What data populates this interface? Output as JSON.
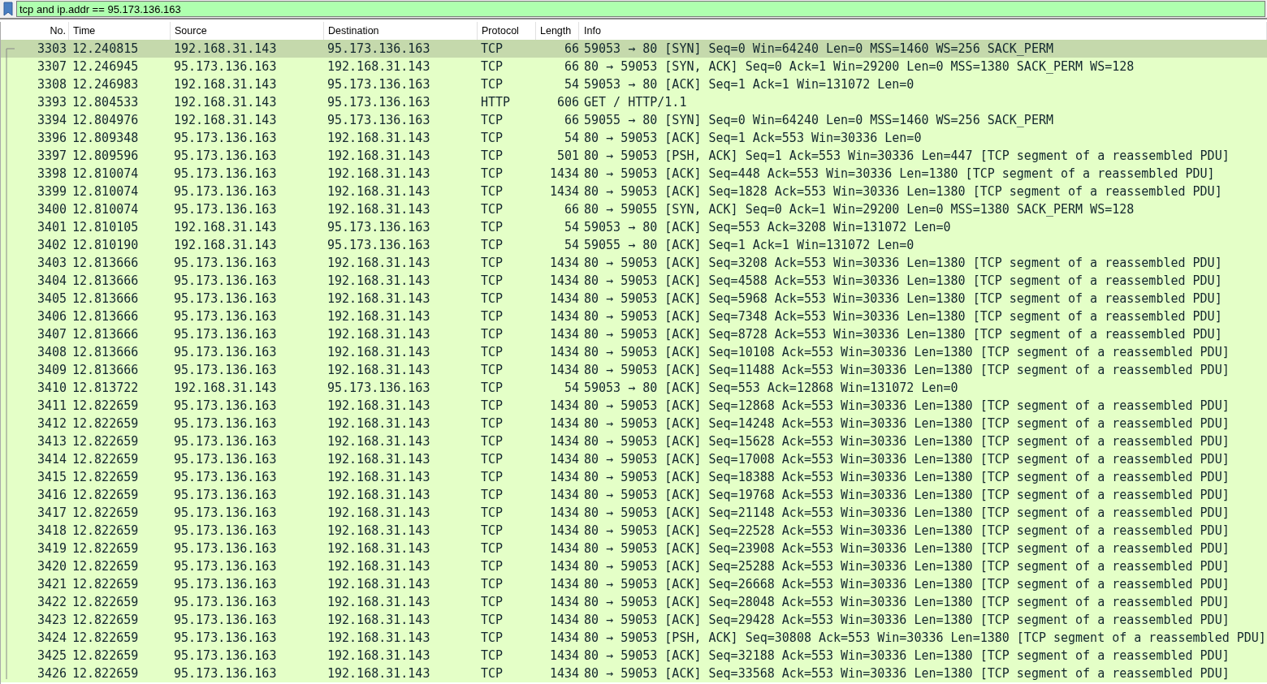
{
  "filter_bar": {
    "value": "tcp and ip.addr == 95.173.136.163"
  },
  "table": {
    "columns": [
      "No.",
      "Time",
      "Source",
      "Destination",
      "Protocol",
      "Length",
      "Info"
    ],
    "rows": [
      {
        "no": "3303",
        "time": "12.240815",
        "source": "192.168.31.143",
        "destination": "95.173.136.163",
        "protocol": "TCP",
        "length": "66",
        "info": "59053 → 80 [SYN] Seq=0 Win=64240 Len=0 MSS=1460 WS=256 SACK_PERM",
        "selected": true
      },
      {
        "no": "3307",
        "time": "12.246945",
        "source": "95.173.136.163",
        "destination": "192.168.31.143",
        "protocol": "TCP",
        "length": "66",
        "info": "80 → 59053 [SYN, ACK] Seq=0 Ack=1 Win=29200 Len=0 MSS=1380 SACK_PERM WS=128",
        "selected": false
      },
      {
        "no": "3308",
        "time": "12.246983",
        "source": "192.168.31.143",
        "destination": "95.173.136.163",
        "protocol": "TCP",
        "length": "54",
        "info": "59053 → 80 [ACK] Seq=1 Ack=1 Win=131072 Len=0",
        "selected": false
      },
      {
        "no": "3393",
        "time": "12.804533",
        "source": "192.168.31.143",
        "destination": "95.173.136.163",
        "protocol": "HTTP",
        "length": "606",
        "info": "GET / HTTP/1.1",
        "selected": false
      },
      {
        "no": "3394",
        "time": "12.804976",
        "source": "192.168.31.143",
        "destination": "95.173.136.163",
        "protocol": "TCP",
        "length": "66",
        "info": "59055 → 80 [SYN] Seq=0 Win=64240 Len=0 MSS=1460 WS=256 SACK_PERM",
        "selected": false
      },
      {
        "no": "3396",
        "time": "12.809348",
        "source": "95.173.136.163",
        "destination": "192.168.31.143",
        "protocol": "TCP",
        "length": "54",
        "info": "80 → 59053 [ACK] Seq=1 Ack=553 Win=30336 Len=0",
        "selected": false
      },
      {
        "no": "3397",
        "time": "12.809596",
        "source": "95.173.136.163",
        "destination": "192.168.31.143",
        "protocol": "TCP",
        "length": "501",
        "info": "80 → 59053 [PSH, ACK] Seq=1 Ack=553 Win=30336 Len=447 [TCP segment of a reassembled PDU]",
        "selected": false
      },
      {
        "no": "3398",
        "time": "12.810074",
        "source": "95.173.136.163",
        "destination": "192.168.31.143",
        "protocol": "TCP",
        "length": "1434",
        "info": "80 → 59053 [ACK] Seq=448 Ack=553 Win=30336 Len=1380 [TCP segment of a reassembled PDU]",
        "selected": false
      },
      {
        "no": "3399",
        "time": "12.810074",
        "source": "95.173.136.163",
        "destination": "192.168.31.143",
        "protocol": "TCP",
        "length": "1434",
        "info": "80 → 59053 [ACK] Seq=1828 Ack=553 Win=30336 Len=1380 [TCP segment of a reassembled PDU]",
        "selected": false
      },
      {
        "no": "3400",
        "time": "12.810074",
        "source": "95.173.136.163",
        "destination": "192.168.31.143",
        "protocol": "TCP",
        "length": "66",
        "info": "80 → 59055 [SYN, ACK] Seq=0 Ack=1 Win=29200 Len=0 MSS=1380 SACK_PERM WS=128",
        "selected": false
      },
      {
        "no": "3401",
        "time": "12.810105",
        "source": "192.168.31.143",
        "destination": "95.173.136.163",
        "protocol": "TCP",
        "length": "54",
        "info": "59053 → 80 [ACK] Seq=553 Ack=3208 Win=131072 Len=0",
        "selected": false
      },
      {
        "no": "3402",
        "time": "12.810190",
        "source": "192.168.31.143",
        "destination": "95.173.136.163",
        "protocol": "TCP",
        "length": "54",
        "info": "59055 → 80 [ACK] Seq=1 Ack=1 Win=131072 Len=0",
        "selected": false
      },
      {
        "no": "3403",
        "time": "12.813666",
        "source": "95.173.136.163",
        "destination": "192.168.31.143",
        "protocol": "TCP",
        "length": "1434",
        "info": "80 → 59053 [ACK] Seq=3208 Ack=553 Win=30336 Len=1380 [TCP segment of a reassembled PDU]",
        "selected": false
      },
      {
        "no": "3404",
        "time": "12.813666",
        "source": "95.173.136.163",
        "destination": "192.168.31.143",
        "protocol": "TCP",
        "length": "1434",
        "info": "80 → 59053 [ACK] Seq=4588 Ack=553 Win=30336 Len=1380 [TCP segment of a reassembled PDU]",
        "selected": false
      },
      {
        "no": "3405",
        "time": "12.813666",
        "source": "95.173.136.163",
        "destination": "192.168.31.143",
        "protocol": "TCP",
        "length": "1434",
        "info": "80 → 59053 [ACK] Seq=5968 Ack=553 Win=30336 Len=1380 [TCP segment of a reassembled PDU]",
        "selected": false
      },
      {
        "no": "3406",
        "time": "12.813666",
        "source": "95.173.136.163",
        "destination": "192.168.31.143",
        "protocol": "TCP",
        "length": "1434",
        "info": "80 → 59053 [ACK] Seq=7348 Ack=553 Win=30336 Len=1380 [TCP segment of a reassembled PDU]",
        "selected": false
      },
      {
        "no": "3407",
        "time": "12.813666",
        "source": "95.173.136.163",
        "destination": "192.168.31.143",
        "protocol": "TCP",
        "length": "1434",
        "info": "80 → 59053 [ACK] Seq=8728 Ack=553 Win=30336 Len=1380 [TCP segment of a reassembled PDU]",
        "selected": false
      },
      {
        "no": "3408",
        "time": "12.813666",
        "source": "95.173.136.163",
        "destination": "192.168.31.143",
        "protocol": "TCP",
        "length": "1434",
        "info": "80 → 59053 [ACK] Seq=10108 Ack=553 Win=30336 Len=1380 [TCP segment of a reassembled PDU]",
        "selected": false
      },
      {
        "no": "3409",
        "time": "12.813666",
        "source": "95.173.136.163",
        "destination": "192.168.31.143",
        "protocol": "TCP",
        "length": "1434",
        "info": "80 → 59053 [ACK] Seq=11488 Ack=553 Win=30336 Len=1380 [TCP segment of a reassembled PDU]",
        "selected": false
      },
      {
        "no": "3410",
        "time": "12.813722",
        "source": "192.168.31.143",
        "destination": "95.173.136.163",
        "protocol": "TCP",
        "length": "54",
        "info": "59053 → 80 [ACK] Seq=553 Ack=12868 Win=131072 Len=0",
        "selected": false
      },
      {
        "no": "3411",
        "time": "12.822659",
        "source": "95.173.136.163",
        "destination": "192.168.31.143",
        "protocol": "TCP",
        "length": "1434",
        "info": "80 → 59053 [ACK] Seq=12868 Ack=553 Win=30336 Len=1380 [TCP segment of a reassembled PDU]",
        "selected": false
      },
      {
        "no": "3412",
        "time": "12.822659",
        "source": "95.173.136.163",
        "destination": "192.168.31.143",
        "protocol": "TCP",
        "length": "1434",
        "info": "80 → 59053 [ACK] Seq=14248 Ack=553 Win=30336 Len=1380 [TCP segment of a reassembled PDU]",
        "selected": false
      },
      {
        "no": "3413",
        "time": "12.822659",
        "source": "95.173.136.163",
        "destination": "192.168.31.143",
        "protocol": "TCP",
        "length": "1434",
        "info": "80 → 59053 [ACK] Seq=15628 Ack=553 Win=30336 Len=1380 [TCP segment of a reassembled PDU]",
        "selected": false
      },
      {
        "no": "3414",
        "time": "12.822659",
        "source": "95.173.136.163",
        "destination": "192.168.31.143",
        "protocol": "TCP",
        "length": "1434",
        "info": "80 → 59053 [ACK] Seq=17008 Ack=553 Win=30336 Len=1380 [TCP segment of a reassembled PDU]",
        "selected": false
      },
      {
        "no": "3415",
        "time": "12.822659",
        "source": "95.173.136.163",
        "destination": "192.168.31.143",
        "protocol": "TCP",
        "length": "1434",
        "info": "80 → 59053 [ACK] Seq=18388 Ack=553 Win=30336 Len=1380 [TCP segment of a reassembled PDU]",
        "selected": false
      },
      {
        "no": "3416",
        "time": "12.822659",
        "source": "95.173.136.163",
        "destination": "192.168.31.143",
        "protocol": "TCP",
        "length": "1434",
        "info": "80 → 59053 [ACK] Seq=19768 Ack=553 Win=30336 Len=1380 [TCP segment of a reassembled PDU]",
        "selected": false
      },
      {
        "no": "3417",
        "time": "12.822659",
        "source": "95.173.136.163",
        "destination": "192.168.31.143",
        "protocol": "TCP",
        "length": "1434",
        "info": "80 → 59053 [ACK] Seq=21148 Ack=553 Win=30336 Len=1380 [TCP segment of a reassembled PDU]",
        "selected": false
      },
      {
        "no": "3418",
        "time": "12.822659",
        "source": "95.173.136.163",
        "destination": "192.168.31.143",
        "protocol": "TCP",
        "length": "1434",
        "info": "80 → 59053 [ACK] Seq=22528 Ack=553 Win=30336 Len=1380 [TCP segment of a reassembled PDU]",
        "selected": false
      },
      {
        "no": "3419",
        "time": "12.822659",
        "source": "95.173.136.163",
        "destination": "192.168.31.143",
        "protocol": "TCP",
        "length": "1434",
        "info": "80 → 59053 [ACK] Seq=23908 Ack=553 Win=30336 Len=1380 [TCP segment of a reassembled PDU]",
        "selected": false
      },
      {
        "no": "3420",
        "time": "12.822659",
        "source": "95.173.136.163",
        "destination": "192.168.31.143",
        "protocol": "TCP",
        "length": "1434",
        "info": "80 → 59053 [ACK] Seq=25288 Ack=553 Win=30336 Len=1380 [TCP segment of a reassembled PDU]",
        "selected": false
      },
      {
        "no": "3421",
        "time": "12.822659",
        "source": "95.173.136.163",
        "destination": "192.168.31.143",
        "protocol": "TCP",
        "length": "1434",
        "info": "80 → 59053 [ACK] Seq=26668 Ack=553 Win=30336 Len=1380 [TCP segment of a reassembled PDU]",
        "selected": false
      },
      {
        "no": "3422",
        "time": "12.822659",
        "source": "95.173.136.163",
        "destination": "192.168.31.143",
        "protocol": "TCP",
        "length": "1434",
        "info": "80 → 59053 [ACK] Seq=28048 Ack=553 Win=30336 Len=1380 [TCP segment of a reassembled PDU]",
        "selected": false
      },
      {
        "no": "3423",
        "time": "12.822659",
        "source": "95.173.136.163",
        "destination": "192.168.31.143",
        "protocol": "TCP",
        "length": "1434",
        "info": "80 → 59053 [ACK] Seq=29428 Ack=553 Win=30336 Len=1380 [TCP segment of a reassembled PDU]",
        "selected": false
      },
      {
        "no": "3424",
        "time": "12.822659",
        "source": "95.173.136.163",
        "destination": "192.168.31.143",
        "protocol": "TCP",
        "length": "1434",
        "info": "80 → 59053 [PSH, ACK] Seq=30808 Ack=553 Win=30336 Len=1380 [TCP segment of a reassembled PDU]",
        "selected": false
      },
      {
        "no": "3425",
        "time": "12.822659",
        "source": "95.173.136.163",
        "destination": "192.168.31.143",
        "protocol": "TCP",
        "length": "1434",
        "info": "80 → 59053 [ACK] Seq=32188 Ack=553 Win=30336 Len=1380 [TCP segment of a reassembled PDU]",
        "selected": false
      },
      {
        "no": "3426",
        "time": "12.822659",
        "source": "95.173.136.163",
        "destination": "192.168.31.143",
        "protocol": "TCP",
        "length": "1434",
        "info": "80 → 59053 [ACK] Seq=33568 Ack=553 Win=30336 Len=1380 [TCP segment of a reassembled PDU]",
        "selected": false
      }
    ]
  }
}
